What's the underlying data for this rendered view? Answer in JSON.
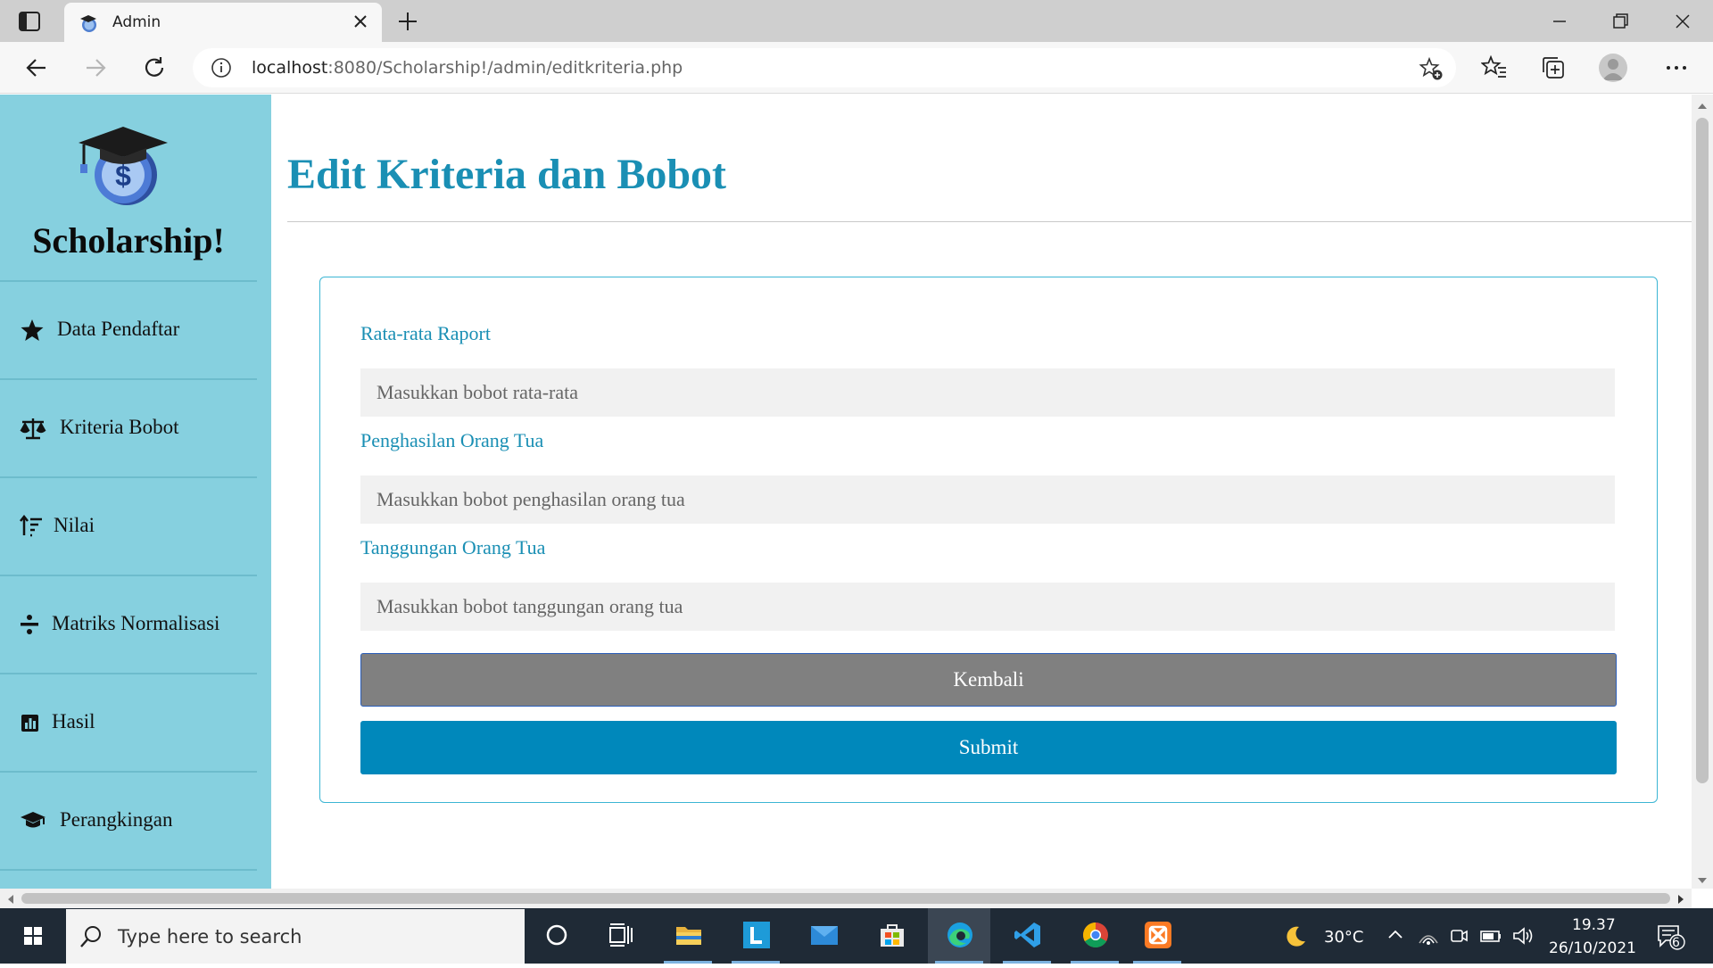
{
  "browser": {
    "tab_title": "Admin",
    "url_host": "localhost",
    "url_rest": ":8080/Scholarship!/admin/editkriteria.php"
  },
  "sidebar": {
    "brand": "Scholarship!",
    "items": [
      {
        "label": "Data Pendaftar",
        "icon": "star-icon"
      },
      {
        "label": "Kriteria Bobot",
        "icon": "balance-scale-icon"
      },
      {
        "label": "Nilai",
        "icon": "sort-amount-icon"
      },
      {
        "label": "Matriks Normalisasi",
        "icon": "divide-icon"
      },
      {
        "label": "Hasil",
        "icon": "bar-chart-icon"
      },
      {
        "label": "Perangkingan",
        "icon": "graduation-cap-icon"
      }
    ]
  },
  "main": {
    "title": "Edit Kriteria dan Bobot",
    "fields": [
      {
        "label": "Rata-rata Raport",
        "placeholder": "Masukkan bobot rata-rata",
        "value": ""
      },
      {
        "label": "Penghasilan Orang Tua",
        "placeholder": "Masukkan bobot penghasilan orang tua",
        "value": ""
      },
      {
        "label": "Tanggungan Orang Tua",
        "placeholder": "Masukkan bobot tanggungan orang tua",
        "value": ""
      }
    ],
    "back_label": "Kembali",
    "submit_label": "Submit"
  },
  "taskbar": {
    "search_placeholder": "Type here to search",
    "temperature": "30°C",
    "time": "19.37",
    "date": "26/10/2021",
    "notification_count": "6"
  },
  "colors": {
    "sidebar_bg": "#86d0df",
    "accent": "#1a8fb4",
    "submit": "#0088bb",
    "back": "#808080"
  }
}
